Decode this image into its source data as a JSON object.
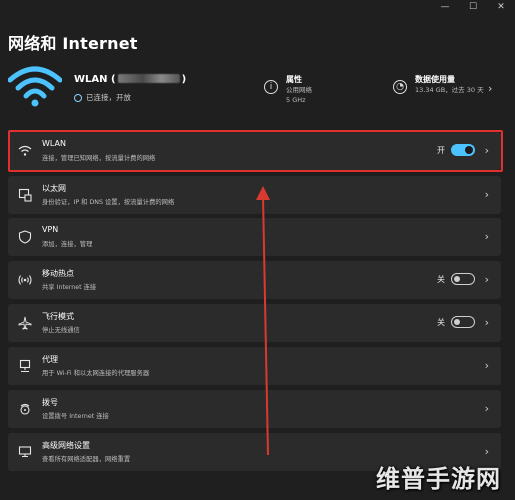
{
  "window": {
    "minimize": "—",
    "maximize": "☐",
    "close": "✕"
  },
  "page_title": "网络和 Internet",
  "summary": {
    "wifi_name_prefix": "WLAN (",
    "wifi_name_suffix": ")",
    "wifi_status": "已连接，开放",
    "properties": {
      "title": "属性",
      "line1": "公用网络",
      "line2": "5 GHz"
    },
    "usage": {
      "title": "数据使用量",
      "line1": "13.34 GB，过去 30 天"
    }
  },
  "rows": [
    {
      "title": "WLAN",
      "sub": "连接，管理已知网络，按流量计费的网络",
      "state": "开",
      "toggle": "on"
    },
    {
      "title": "以太网",
      "sub": "身份验证，IP 和 DNS 设置，按流量计费的网络"
    },
    {
      "title": "VPN",
      "sub": "添加，连接，管理"
    },
    {
      "title": "移动热点",
      "sub": "共享 Internet 连接",
      "state": "关",
      "toggle": "off"
    },
    {
      "title": "飞行模式",
      "sub": "停止无线通信",
      "state": "关",
      "toggle": "off"
    },
    {
      "title": "代理",
      "sub": "用于 Wi-Fi 和以太网连接的代理服务器"
    },
    {
      "title": "拨号",
      "sub": "设置拨号 Internet 连接"
    },
    {
      "title": "高级网络设置",
      "sub": "查看所有网络适配器，网络重置"
    }
  ],
  "watermark": "维普手游网",
  "colors": {
    "accent": "#4cc2ff",
    "highlight": "#e03030",
    "arrow": "#d93a2f",
    "background": "#1f1f1f",
    "row": "#2b2b2b"
  }
}
